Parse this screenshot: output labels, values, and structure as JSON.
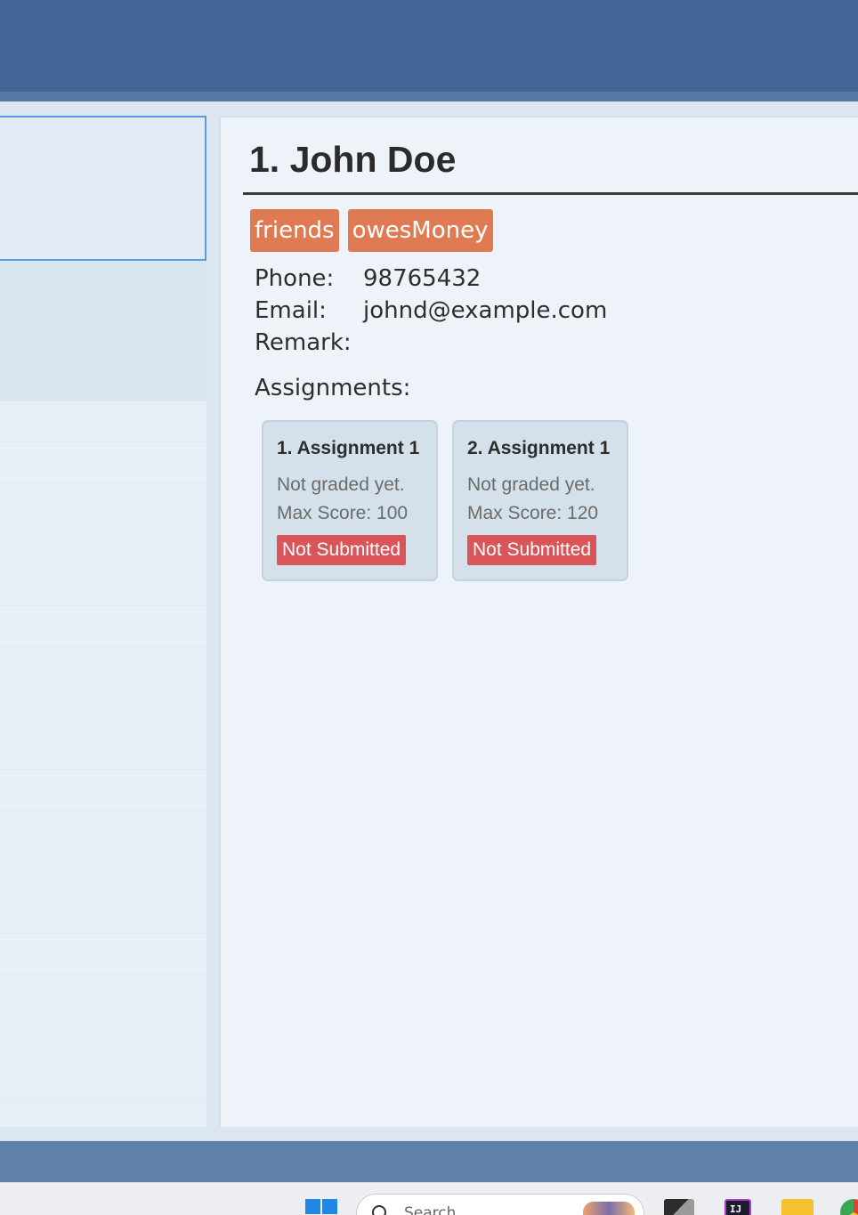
{
  "person": {
    "index_name": "1. John Doe",
    "tags": [
      "friends",
      "owesMoney"
    ],
    "phone_label": "Phone:",
    "phone": "98765432",
    "email_label": "Email:",
    "email": "johnd@example.com",
    "remark_label": "Remark:",
    "remark": ""
  },
  "assignments": {
    "heading": "Assignments:",
    "cards": [
      {
        "title": "1. Assignment 1",
        "grade": "Not graded yet.",
        "max_score": "Max Score: 100",
        "status": "Not Submitted"
      },
      {
        "title": "2. Assignment 1",
        "grade": "Not graded yet.",
        "max_score": "Max Score: 120",
        "status": "Not Submitted"
      }
    ]
  },
  "taskbar": {
    "search_placeholder": "Search",
    "icons": [
      "windows-start-icon",
      "search-icon",
      "task-view-icon",
      "intellij-icon",
      "file-explorer-icon",
      "chrome-icon"
    ]
  },
  "colors": {
    "top_bar": "#416696",
    "tag": "#e07a52",
    "status_not_submitted": "#d9555a",
    "card_bg": "#d4e1ea",
    "selection_border": "#5a9ce0"
  }
}
